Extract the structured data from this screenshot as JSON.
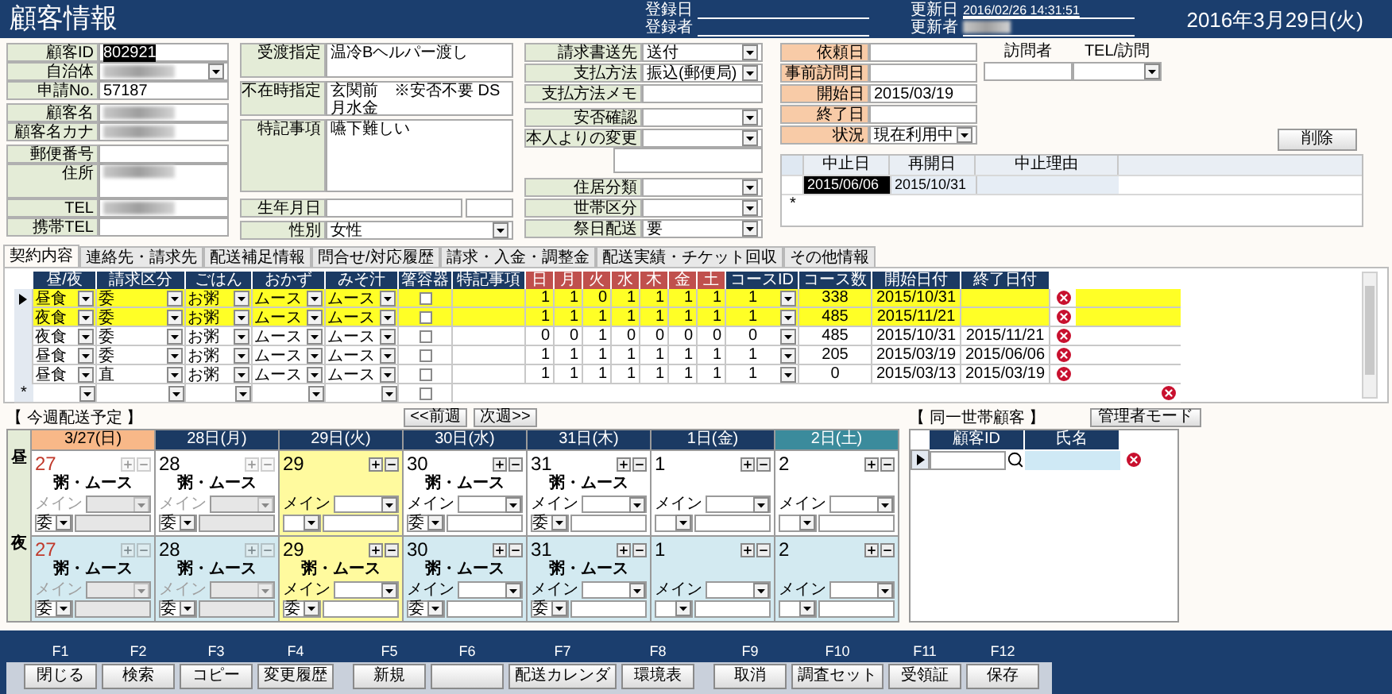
{
  "header": {
    "title": "顧客情報",
    "date": "2016年3月29日(火)",
    "meta": [
      {
        "label": "登録日"
      },
      {
        "label": "登録者"
      },
      {
        "label": "更新日",
        "value": "2016/02/26 14:31:51"
      },
      {
        "label": "更新者",
        "redacted": true
      }
    ]
  },
  "customer": [
    {
      "label": "顧客ID",
      "value": "802921",
      "kind": "text",
      "focused": true
    },
    {
      "label": "自治体",
      "kind": "dropdown",
      "redacted": true
    },
    {
      "label": "申請No.",
      "value": "57187",
      "kind": "text"
    },
    {
      "label": "顧客名",
      "kind": "text",
      "redacted": true
    },
    {
      "label": "顧客名カナ",
      "kind": "text",
      "redacted": true
    },
    {
      "label": "郵便番号",
      "kind": "text"
    },
    {
      "label": "住所",
      "kind": "area",
      "redacted": true
    },
    {
      "label": "TEL",
      "kind": "text",
      "redacted": true
    },
    {
      "label": "携帯TEL",
      "kind": "text"
    }
  ],
  "delivery": [
    {
      "label": "受渡指定",
      "value": "温冷Bヘルパー渡し",
      "kind": "area"
    },
    {
      "label": "不在時指定",
      "value": "玄関前　※安否不要 DS月水金",
      "kind": "area"
    },
    {
      "label": "特記事項",
      "value": "嚥下難しい",
      "kind": "memo"
    },
    {
      "label": "生年月日",
      "kind": "date"
    },
    {
      "label": "性別",
      "value": "女性",
      "kind": "dropdown"
    }
  ],
  "billing": [
    {
      "label": "請求書送先",
      "value": "送付",
      "kind": "dropdown"
    },
    {
      "label": "支払方法",
      "value": "振込(郵便局)",
      "kind": "dropdown"
    },
    {
      "label": "支払方法メモ",
      "kind": "text"
    },
    {
      "label": "安否確認",
      "kind": "dropdown"
    },
    {
      "label": "本人よりの変更",
      "kind": "dropnote"
    },
    {
      "label": "住居分類",
      "kind": "dropdown"
    },
    {
      "label": "世帯区分",
      "kind": "dropdown"
    },
    {
      "label": "祭日配送",
      "value": "要",
      "kind": "dropdown"
    }
  ],
  "service": [
    {
      "label": "依頼日",
      "kind": "text"
    },
    {
      "label": "事前訪問日",
      "kind": "text"
    },
    {
      "label": "開始日",
      "value": "2015/03/19",
      "kind": "text"
    },
    {
      "label": "終了日",
      "kind": "text"
    },
    {
      "label": "状況",
      "value": "現在利用中",
      "kind": "dropdown"
    }
  ],
  "visit": {
    "columns": [
      "訪問者",
      "TEL/訪問"
    ]
  },
  "delete_button": "削除",
  "suspensions": {
    "columns": [
      "中止日",
      "再開日",
      "中止理由"
    ],
    "rows": [
      {
        "stop": "2015/06/06",
        "resume": "2015/10/31"
      }
    ],
    "new_row_marker": "*"
  },
  "tabs": [
    {
      "label": "契約内容",
      "selected": true
    },
    {
      "label": "連絡先・請求先",
      "selected": false
    },
    {
      "label": "配送補足情報",
      "selected": false
    },
    {
      "label": "問合せ/対応履歴",
      "selected": false
    },
    {
      "label": "請求・入金・調整金",
      "selected": false
    },
    {
      "label": "配送実績・チケット回収",
      "selected": false
    },
    {
      "label": "その他情報",
      "selected": false
    }
  ],
  "contracts": {
    "columns": [
      {
        "label": "昼/夜",
        "kind": "field"
      },
      {
        "label": "請求区分",
        "kind": "field"
      },
      {
        "label": "ごはん",
        "kind": "field"
      },
      {
        "label": "おかず",
        "kind": "field"
      },
      {
        "label": "みそ汁",
        "kind": "field"
      },
      {
        "label": "箸容器",
        "kind": "field"
      },
      {
        "label": "特記事項",
        "kind": "field"
      },
      {
        "label": "日",
        "kind": "day"
      },
      {
        "label": "月",
        "kind": "day"
      },
      {
        "label": "火",
        "kind": "day"
      },
      {
        "label": "水",
        "kind": "day"
      },
      {
        "label": "木",
        "kind": "day"
      },
      {
        "label": "金",
        "kind": "day"
      },
      {
        "label": "土",
        "kind": "day"
      },
      {
        "label": "コースID",
        "kind": "field"
      },
      {
        "label": "コース数",
        "kind": "field"
      },
      {
        "label": "開始日付",
        "kind": "field"
      },
      {
        "label": "終了日付",
        "kind": "field"
      }
    ],
    "rows": [
      {
        "meal": "昼食",
        "billing": "委",
        "rice": "お粥",
        "side": "ムース",
        "soup": "ムース",
        "chopsticks": false,
        "days": [
          "1",
          "1",
          "0",
          "1",
          "1",
          "1",
          "1"
        ],
        "course_id": "1",
        "course_count": "338",
        "start": "2015/10/31",
        "highlighted": true,
        "current": true
      },
      {
        "meal": "夜食",
        "billing": "委",
        "rice": "お粥",
        "side": "ムース",
        "soup": "ムース",
        "chopsticks": false,
        "days": [
          "1",
          "1",
          "1",
          "1",
          "1",
          "1",
          "1"
        ],
        "course_id": "1",
        "course_count": "485",
        "start": "2015/11/21",
        "highlighted": true,
        "current": false
      },
      {
        "meal": "夜食",
        "billing": "委",
        "rice": "お粥",
        "side": "ムース",
        "soup": "ムース",
        "chopsticks": false,
        "days": [
          "0",
          "0",
          "1",
          "0",
          "0",
          "0",
          "0"
        ],
        "course_id": "0",
        "course_count": "485",
        "start": "2015/10/31",
        "end": "2015/11/21",
        "highlighted": false,
        "current": false
      },
      {
        "meal": "昼食",
        "billing": "委",
        "rice": "お粥",
        "side": "ムース",
        "soup": "ムース",
        "chopsticks": false,
        "days": [
          "1",
          "1",
          "1",
          "1",
          "1",
          "1",
          "1"
        ],
        "course_id": "1",
        "course_count": "205",
        "start": "2015/03/19",
        "end": "2015/06/06",
        "highlighted": false,
        "current": false
      },
      {
        "meal": "昼食",
        "billing": "直",
        "rice": "お粥",
        "side": "ムース",
        "soup": "ムース",
        "chopsticks": false,
        "days": [
          "1",
          "1",
          "1",
          "1",
          "1",
          "1",
          "1"
        ],
        "course_id": "1",
        "course_count": "0",
        "start": "2015/03/13",
        "end": "2015/03/19",
        "highlighted": false,
        "current": false
      }
    ],
    "new_row_marker": "*",
    "new_row_checked": false
  },
  "schedule": {
    "title": "【 今週配送予定 】",
    "prev": "<<前週",
    "next": "次週>>",
    "days": [
      {
        "label": "3/27(日)",
        "color": "#f8b888",
        "holiday": true
      },
      {
        "label": "28日(月)",
        "color": "#1b3a63",
        "holiday": false
      },
      {
        "label": "29日(火)",
        "color": "#1b3a63",
        "holiday": false
      },
      {
        "label": "30日(水)",
        "color": "#1b3a63",
        "holiday": false
      },
      {
        "label": "31日(木)",
        "color": "#1b3a63",
        "holiday": false
      },
      {
        "label": "1日(金)",
        "color": "#1b3a63",
        "holiday": false
      },
      {
        "label": "2日(土)",
        "color": "#3b8b9c",
        "holiday": false
      }
    ],
    "rows": [
      {
        "label": "昼",
        "kind": "day",
        "cells": [
          {
            "day": "27",
            "past": true,
            "today": false,
            "menu": "粥・ムース",
            "main_label": "メイン",
            "billing": "委"
          },
          {
            "day": "28",
            "past": true,
            "today": false,
            "menu": "粥・ムース",
            "main_label": "メイン",
            "billing": "委"
          },
          {
            "day": "29",
            "past": false,
            "today": true,
            "main_label": "メイン"
          },
          {
            "day": "30",
            "past": false,
            "today": false,
            "menu": "粥・ムース",
            "main_label": "メイン",
            "billing": "委"
          },
          {
            "day": "31",
            "past": false,
            "today": false,
            "menu": "粥・ムース",
            "main_label": "メイン",
            "billing": "委"
          },
          {
            "day": "1",
            "past": false,
            "today": false,
            "main_label": "メイン"
          },
          {
            "day": "2",
            "past": false,
            "today": false,
            "main_label": "メイン"
          }
        ]
      },
      {
        "label": "夜",
        "kind": "night",
        "cells": [
          {
            "day": "27",
            "past": true,
            "today": false,
            "menu": "粥・ムース",
            "main_label": "メイン",
            "billing": "委"
          },
          {
            "day": "28",
            "past": true,
            "today": false,
            "menu": "粥・ムース",
            "main_label": "メイン",
            "billing": "委"
          },
          {
            "day": "29",
            "past": false,
            "today": true,
            "menu": "粥・ムース",
            "main_label": "メイン",
            "billing": "委"
          },
          {
            "day": "30",
            "past": false,
            "today": false,
            "menu": "粥・ムース",
            "main_label": "メイン",
            "billing": "委"
          },
          {
            "day": "31",
            "past": false,
            "today": false,
            "menu": "粥・ムース",
            "main_label": "メイン",
            "billing": "委"
          },
          {
            "day": "1",
            "past": false,
            "today": false,
            "main_label": "メイン"
          },
          {
            "day": "2",
            "past": false,
            "today": false,
            "main_label": "メイン"
          }
        ]
      }
    ]
  },
  "household": {
    "title": "【 同一世帯顧客 】",
    "mode_button": "管理者モード",
    "columns": [
      "顧客ID",
      "氏名"
    ]
  },
  "function_keys": [
    {
      "key": "F1",
      "label": "閉じる"
    },
    {
      "key": "F2",
      "label": "検索"
    },
    {
      "key": "F3",
      "label": "コピー"
    },
    {
      "key": "F4",
      "label": "変更履歴"
    },
    {
      "key": "F5",
      "label": "新規"
    },
    {
      "key": "F6"
    },
    {
      "key": "F7",
      "label": "配送カレンダ"
    },
    {
      "key": "F8",
      "label": "環境表"
    },
    {
      "key": "F9",
      "label": "取消"
    },
    {
      "key": "F10",
      "label": "調査セット"
    },
    {
      "key": "F11",
      "label": "受領証"
    },
    {
      "key": "F12",
      "label": "保存"
    }
  ]
}
